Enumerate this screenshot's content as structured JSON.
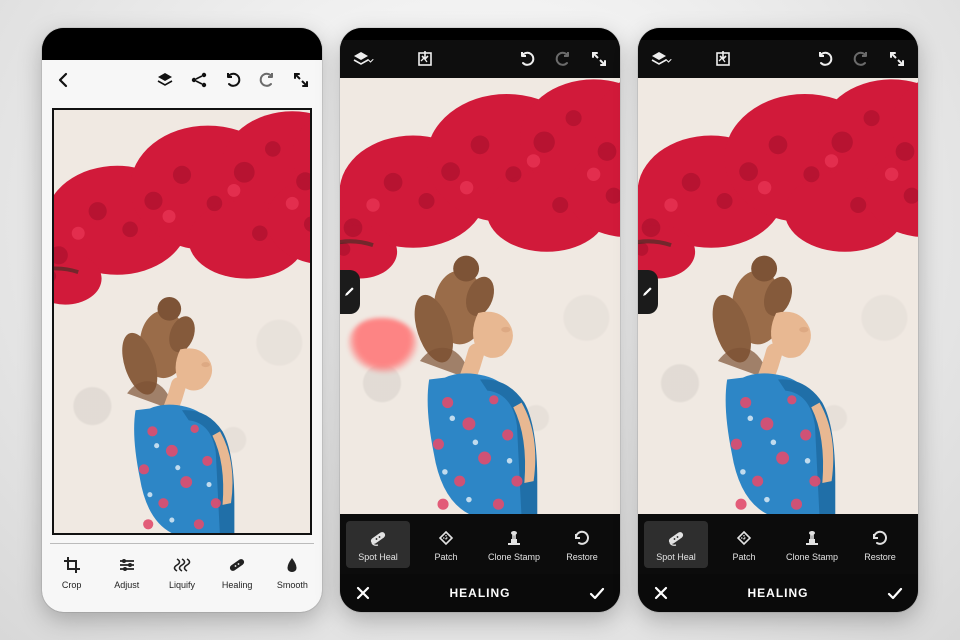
{
  "phone1": {
    "tools": [
      {
        "id": "crop",
        "label": "Crop"
      },
      {
        "id": "adjust",
        "label": "Adjust"
      },
      {
        "id": "liquify",
        "label": "Liquify"
      },
      {
        "id": "healing",
        "label": "Healing"
      },
      {
        "id": "smooth",
        "label": "Smooth"
      }
    ]
  },
  "healing": {
    "title": "HEALING",
    "tools": [
      {
        "id": "spot-heal",
        "label": "Spot Heal"
      },
      {
        "id": "patch",
        "label": "Patch"
      },
      {
        "id": "clone-stamp",
        "label": "Clone Stamp"
      },
      {
        "id": "restore",
        "label": "Restore"
      }
    ]
  }
}
